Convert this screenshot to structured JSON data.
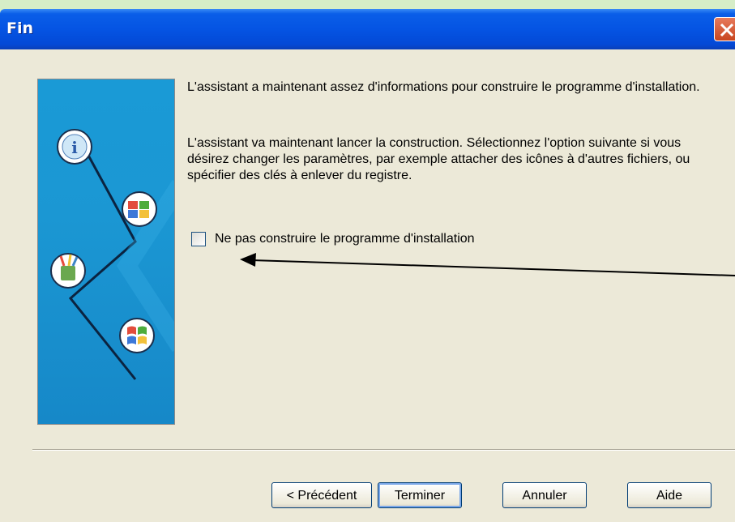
{
  "window": {
    "title": "Fin"
  },
  "content": {
    "paragraph1": "L'assistant a maintenant assez d'informations pour construire le programme d'installation.",
    "paragraph2": "L'assistant va maintenant lancer la construction. Sélectionnez l'option suivante si vous désirez changer les paramètres, par exemple attacher des icônes à d'autres fichiers, ou spécifier des clés à enlever du registre.",
    "checkbox": {
      "label": "Ne pas construire le programme d'installation",
      "checked": false
    }
  },
  "banner": {
    "icons": [
      "info-icon",
      "applications-icon",
      "tools-icon",
      "windows-logo-icon"
    ]
  },
  "buttons": {
    "previous": "< Précédent",
    "finish": "Terminer",
    "cancel": "Annuler",
    "help": "Aide"
  },
  "colors": {
    "titlebar": "#0554e3",
    "background": "#d6edc7",
    "dialog": "#ece9d8",
    "banner": "#1a9ad6"
  }
}
